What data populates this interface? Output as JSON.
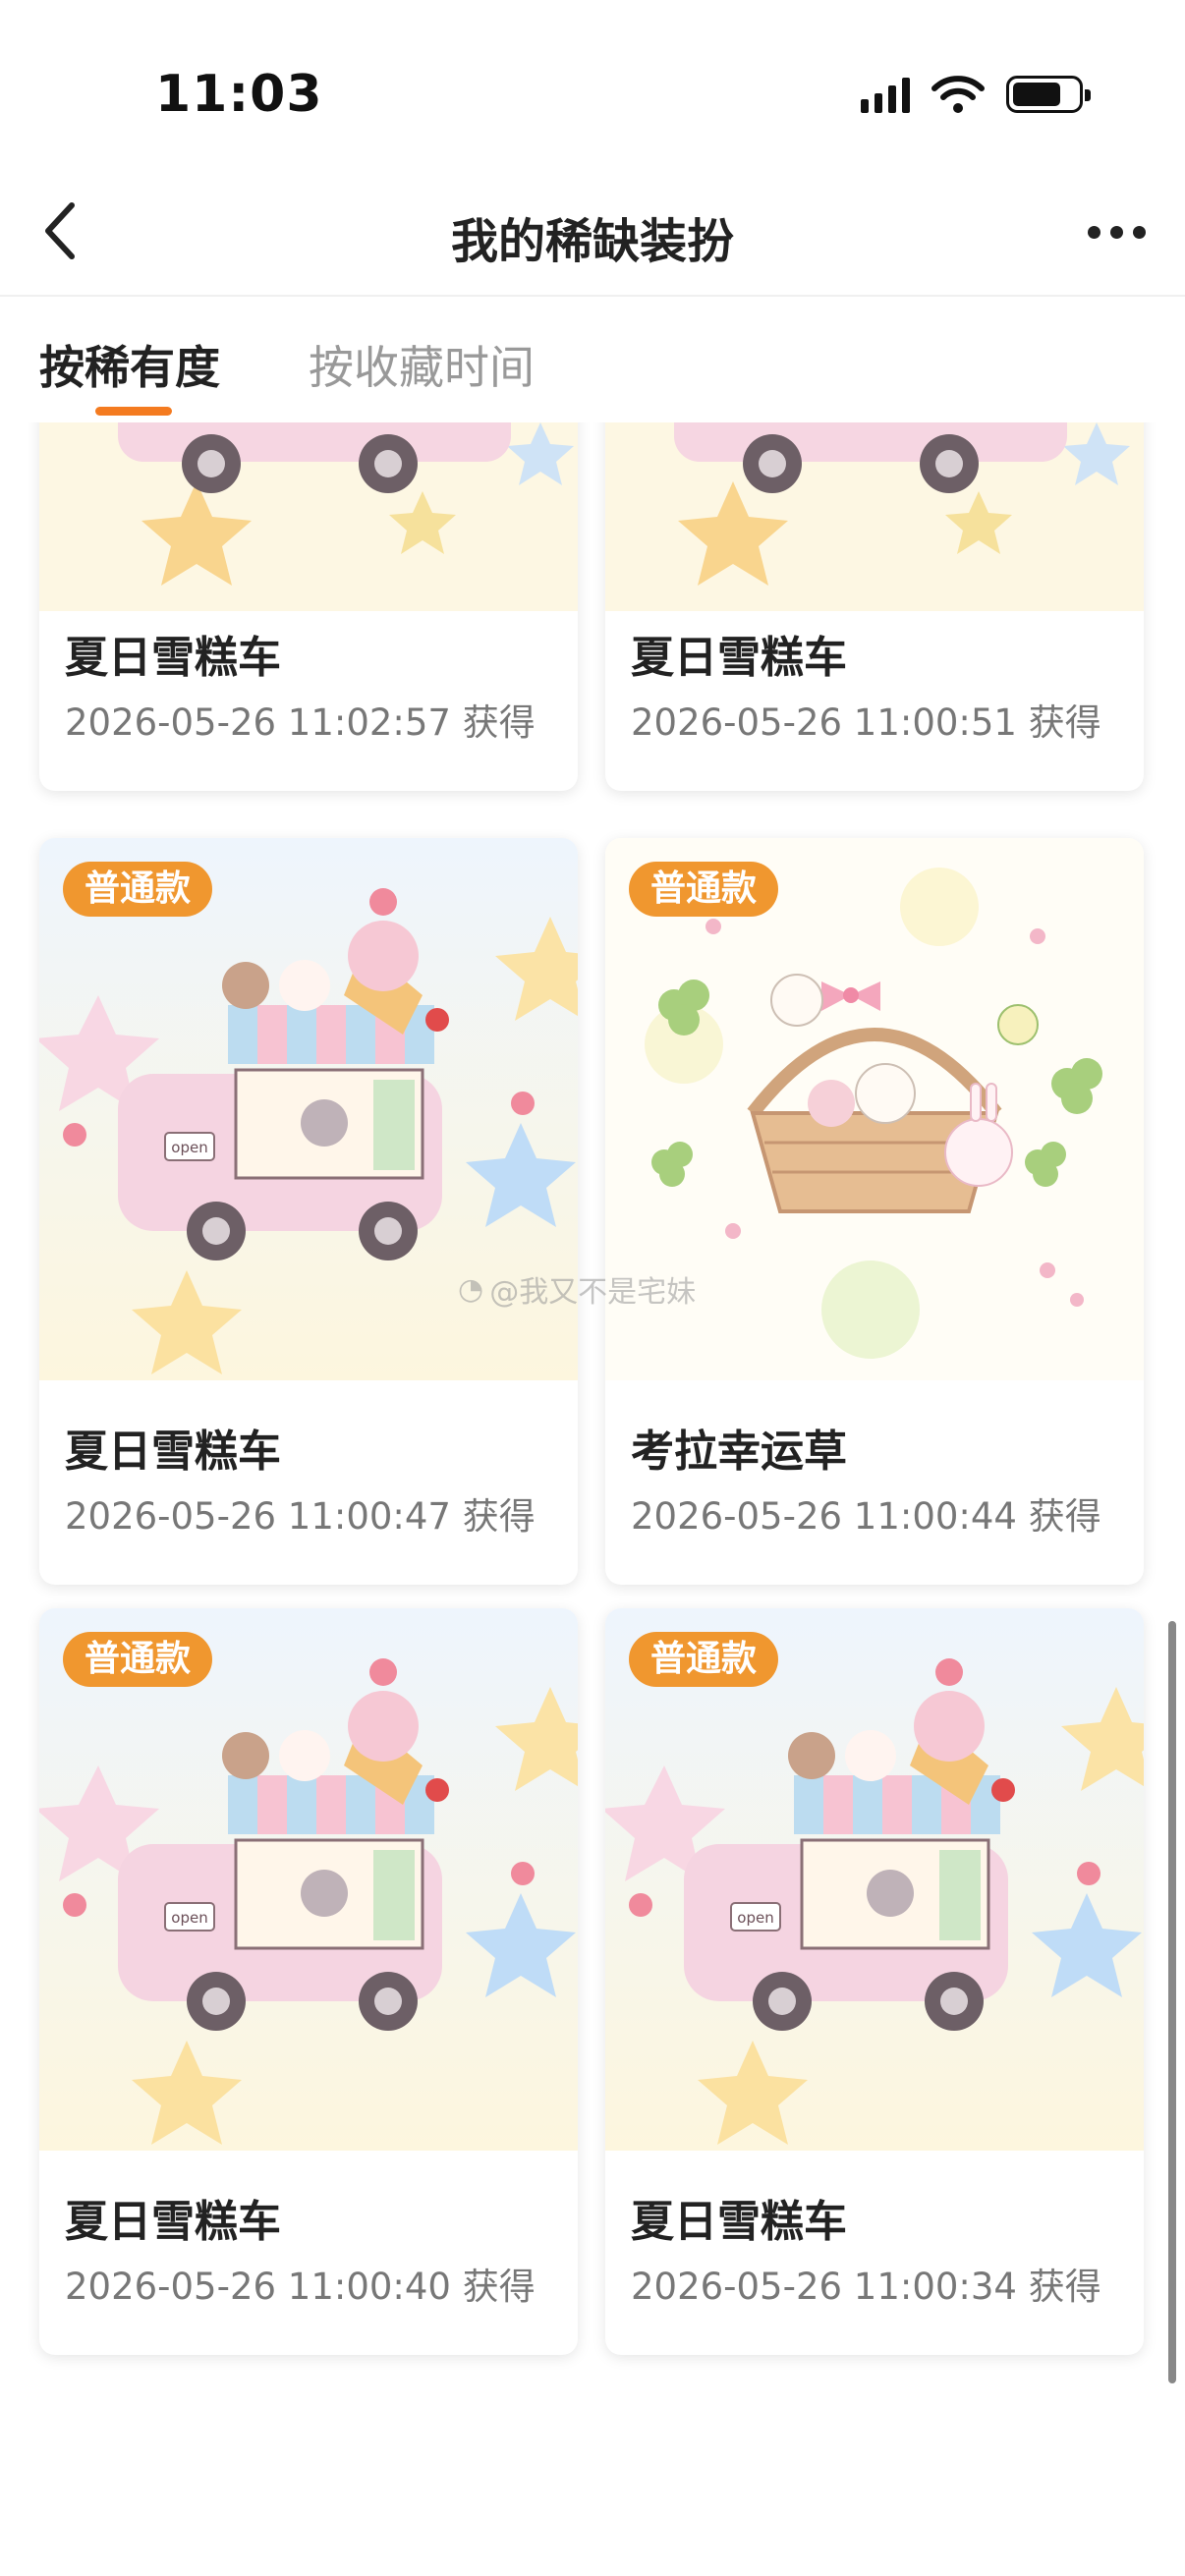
{
  "status_bar": {
    "time": "11:03"
  },
  "nav": {
    "title": "我的稀缺装扮"
  },
  "sort_tabs": [
    {
      "label": "按稀有度",
      "active": true
    },
    {
      "label": "按收藏时间",
      "active": false
    }
  ],
  "items": [
    {
      "name": "夏日雪糕车",
      "obtained": "2026-05-26 11:02:57 获得",
      "image": "ice-cream-truck"
    },
    {
      "name": "夏日雪糕车",
      "obtained": "2026-05-26 11:00:51 获得",
      "image": "ice-cream-truck"
    },
    {
      "badge": "普通款",
      "name": "夏日雪糕车",
      "obtained": "2026-05-26 11:00:47 获得",
      "image": "ice-cream-truck"
    },
    {
      "badge": "普通款",
      "name": "考拉幸运草",
      "obtained": "2026-05-26 11:00:44 获得",
      "image": "koala-clover-basket"
    },
    {
      "badge": "普通款",
      "name": "夏日雪糕车",
      "obtained": "2026-05-26 11:00:40 获得",
      "image": "ice-cream-truck"
    },
    {
      "badge": "普通款",
      "name": "夏日雪糕车",
      "obtained": "2026-05-26 11:00:34 获得",
      "image": "ice-cream-truck"
    }
  ],
  "watermark": "@我又不是宅妹",
  "colors": {
    "accent": "#f47b20",
    "badge": "#f0972f"
  }
}
